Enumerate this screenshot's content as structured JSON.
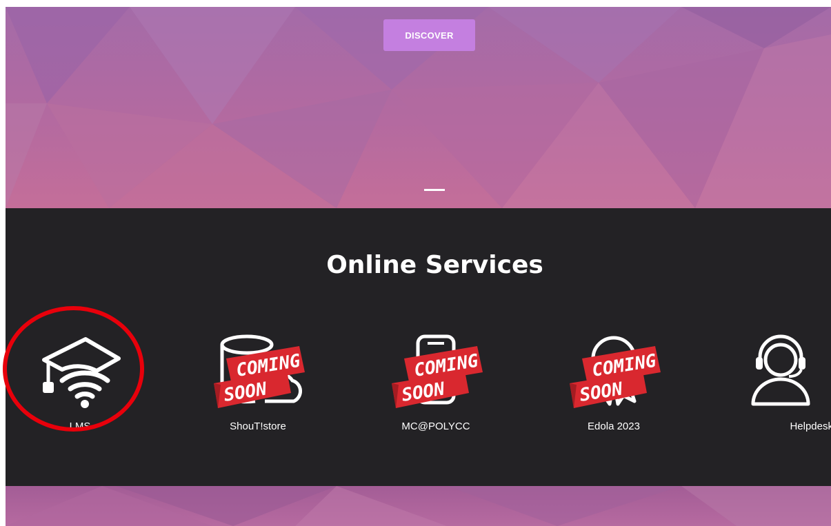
{
  "hero": {
    "discover_label": "DISCOVER"
  },
  "services": {
    "title": "Online Services",
    "coming_soon_line1": "COMING",
    "coming_soon_line2": "SOON",
    "items": [
      {
        "label": "LMS",
        "icon": "graduation-cap-wifi-icon",
        "coming_soon": false
      },
      {
        "label": "ShouT!store",
        "icon": "database-cloud-icon",
        "coming_soon": true
      },
      {
        "label": "MC@POLYCC",
        "icon": "mobile-book-icon",
        "coming_soon": true
      },
      {
        "label": "Edola 2023",
        "icon": "award-badge-icon",
        "coming_soon": true
      },
      {
        "label": "Helpdesk",
        "icon": "headset-support-icon",
        "coming_soon": false
      }
    ]
  },
  "colors": {
    "hero_gradient_top": "#a46ba8",
    "hero_gradient_bottom": "#c46e99",
    "button": "#c47fe0",
    "services_bg": "#232225",
    "ribbon_red": "#d9282f",
    "highlight_circle": "#e8000b"
  }
}
